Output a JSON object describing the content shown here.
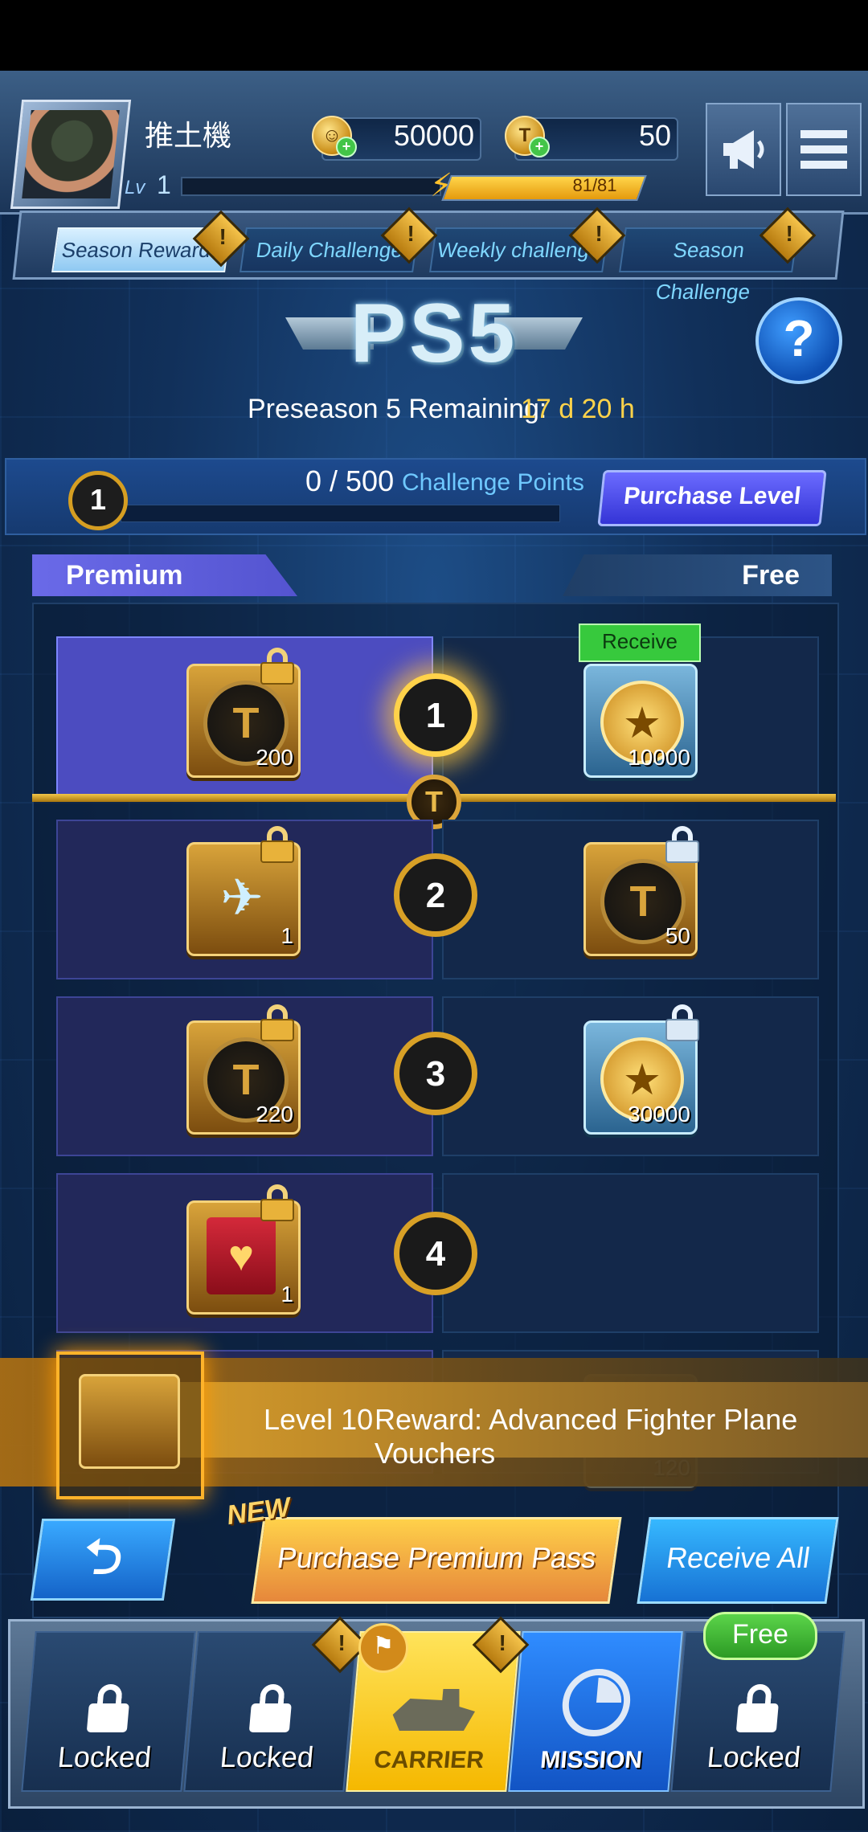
{
  "header": {
    "player_name": "推土機",
    "level_label": "Lv",
    "level_value": "1",
    "currency_gold": "50000",
    "currency_t": "50",
    "energy_text": "81/81",
    "energy_fraction": 1.0
  },
  "tabs": [
    {
      "label": "Season Rewards",
      "active": true
    },
    {
      "label": "Daily Challenge",
      "active": false
    },
    {
      "label": "Weekly challenge",
      "active": false
    },
    {
      "label": "Season Challenge",
      "active": false
    }
  ],
  "season": {
    "logo": "PS5",
    "remaining_label": "Preseason 5 Remaining:",
    "remaining_value": "17 d 20 h",
    "help": "?"
  },
  "progress": {
    "level": "1",
    "points": "0 / 500",
    "points_label": "Challenge Points",
    "fraction": 0.0,
    "purchase_label": "Purchase Level"
  },
  "lanes": {
    "premium": "Premium",
    "free": "Free",
    "receive_tag": "Receive"
  },
  "rows": [
    {
      "level": "1",
      "premium_qty": "200",
      "premium_icon": "t-coin-icon",
      "free_qty": "10000",
      "free_icon": "medal-coin-icon"
    },
    {
      "level": "2",
      "premium_qty": "1",
      "premium_icon": "fighter-jet-icon",
      "free_qty": "50",
      "free_icon": "t-coin-icon"
    },
    {
      "level": "3",
      "premium_qty": "220",
      "premium_icon": "t-coin-icon",
      "free_qty": "30000",
      "free_icon": "medal-coin-icon"
    },
    {
      "level": "4",
      "premium_qty": "1",
      "premium_icon": "red-book-icon",
      "free_qty": "",
      "free_icon": ""
    }
  ],
  "banner": {
    "level": "Level 10",
    "text": "Reward: Advanced Fighter Plane Vouchers",
    "hidden_qty": "120"
  },
  "actions": {
    "back": "⮌",
    "new_badge": "NEW",
    "purchase_pass": "Purchase Premium Pass",
    "receive_all": "Receive All"
  },
  "nav": [
    {
      "label": "Locked",
      "type": "locked"
    },
    {
      "label": "Locked",
      "type": "locked"
    },
    {
      "label": "CARRIER",
      "type": "carrier"
    },
    {
      "label": "MISSION",
      "type": "mission"
    },
    {
      "label": "Locked",
      "type": "locked"
    }
  ],
  "nav_free_badge": "Free",
  "colors": {
    "accent_gold": "#ffd34a",
    "premium": "#5454d0",
    "receive_green": "#37c93d"
  }
}
